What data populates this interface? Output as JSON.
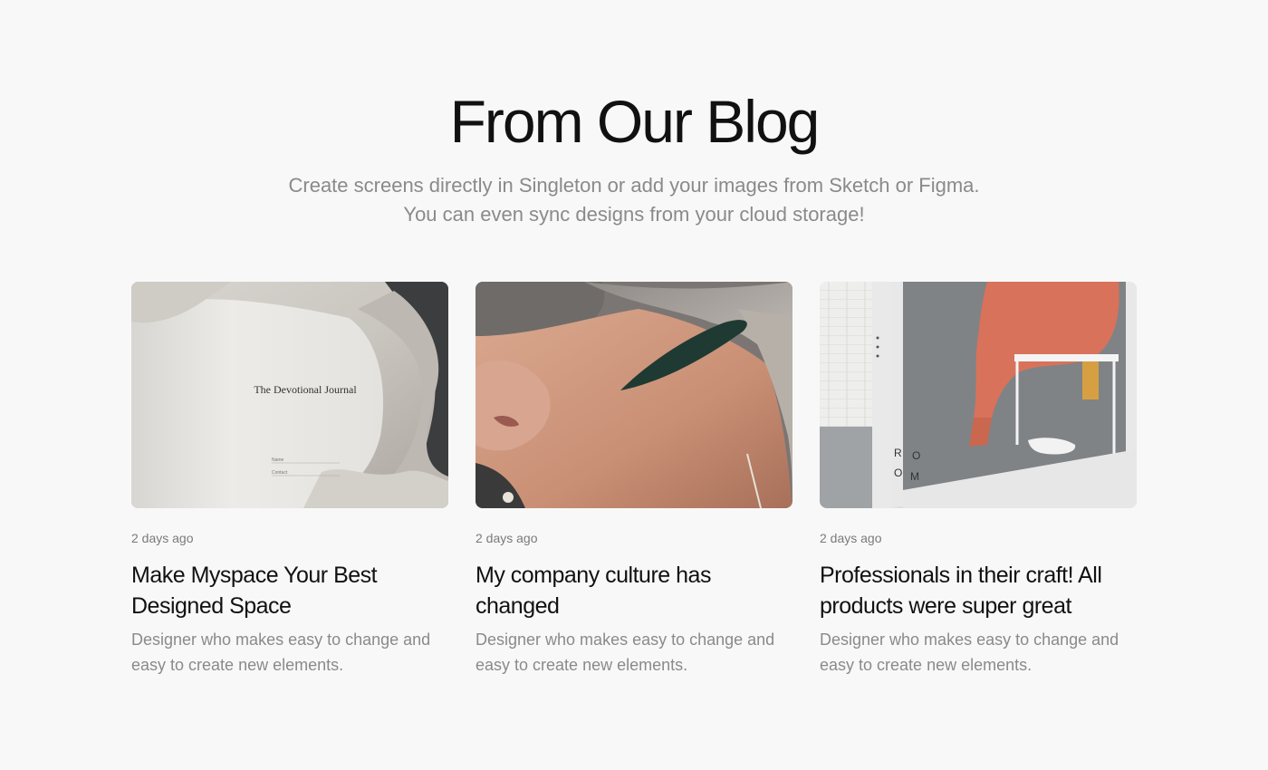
{
  "section": {
    "heading": "From Our Blog",
    "subtitle": "Create screens directly in Singleton or add your images from Sketch or Figma. You can even sync designs from your cloud storage!"
  },
  "posts": [
    {
      "date": "2 days ago",
      "title": "Make Myspace Your Best Designed Space",
      "excerpt": "Designer who makes easy to change and easy to create new elements.",
      "image": {
        "kind": "journal-photo",
        "journal_title": "The Devotional Journal",
        "field_labels": [
          "Name",
          "Contact"
        ]
      }
    },
    {
      "date": "2 days ago",
      "title": "My company culture has changed",
      "excerpt": "Designer who makes easy to change and easy to create new elements.",
      "image": {
        "kind": "portrait-photo"
      }
    },
    {
      "date": "2 days ago",
      "title": "Professionals in their craft! All products were super great",
      "excerpt": "Designer who makes easy to change and easy to create new elements.",
      "image": {
        "kind": "room-photo",
        "door_letters": [
          "R",
          "O",
          "O",
          "M"
        ]
      }
    }
  ],
  "colors": {
    "background": "#f8f8f8",
    "heading": "#111111",
    "muted": "#8a8a8a"
  }
}
